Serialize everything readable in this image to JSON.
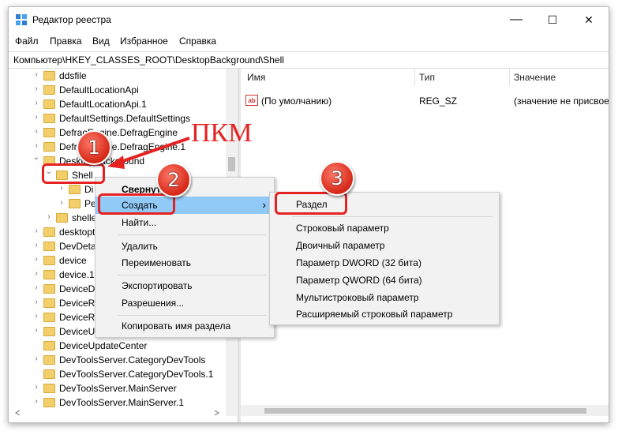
{
  "window": {
    "title": "Редактор реестра",
    "minimize": "—",
    "maximize": "☐",
    "close": "✕"
  },
  "menu": [
    "Файл",
    "Правка",
    "Вид",
    "Избранное",
    "Справка"
  ],
  "address": "Компьютер\\HKEY_CLASSES_ROOT\\DesktopBackground\\Shell",
  "tree": [
    "ddsfile",
    "DefaultLocationApi",
    "DefaultLocationApi.1",
    "DefaultSettings.DefaultSettings",
    "DefragEngine.DefragEngine",
    "DefragEngine.DefragEngine.1",
    "DesktopBackground",
    "Shell",
    "Di",
    "Pe",
    "shellex",
    "desktopt",
    "DevDeta",
    "device",
    "device.1",
    "DeviceD",
    "DeviceRe",
    "DeviceRe",
    "DeviceU",
    "DeviceUpdateCenter",
    "DevToolsServer.CategoryDevTools",
    "DevToolsServer.CategoryDevTools.1",
    "DevToolsServer.MainServer",
    "DevToolsServer.MainServer.1"
  ],
  "columns": {
    "name": "Имя",
    "type": "Тип",
    "value": "Значение"
  },
  "row": {
    "icon_text": "ab",
    "name": "(По умолчанию)",
    "type": "REG_SZ",
    "value": "(значение не присвое"
  },
  "context_menu": {
    "items": [
      "Свернуть",
      "Создать",
      "Найти...",
      "Удалить",
      "Переименовать",
      "Экспортировать",
      "Разрешения...",
      "Копировать имя раздела"
    ],
    "arrow": "›"
  },
  "submenu": [
    "Раздел",
    "Строковый параметр",
    "Двоичный параметр",
    "Параметр DWORD (32 бита)",
    "Параметр QWORD (64 бита)",
    "Мультистроковый параметр",
    "Расширяемый строковый параметр"
  ],
  "annotations": {
    "pkm": "ПКМ",
    "badge1": "1",
    "badge2": "2",
    "badge3": "3",
    "accent": "#e52222"
  }
}
